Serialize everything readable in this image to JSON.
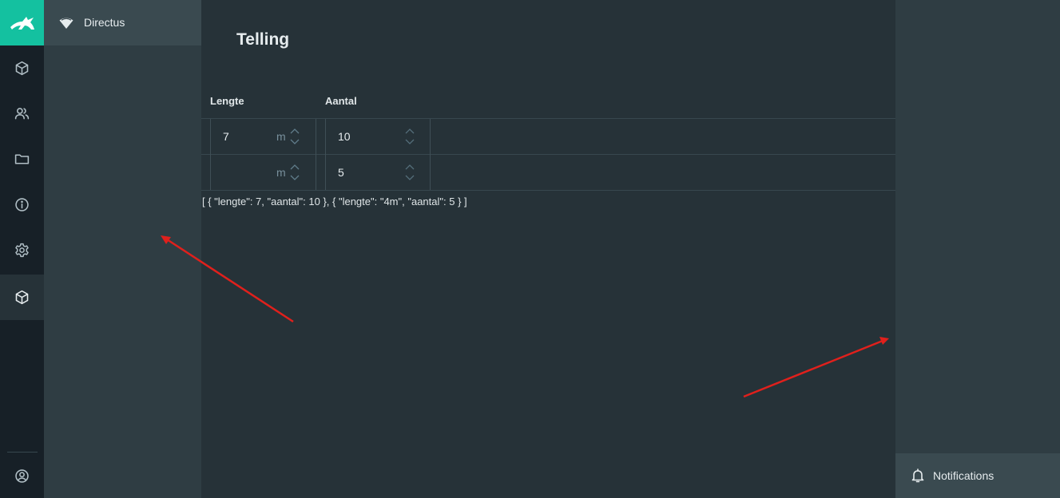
{
  "project": {
    "name": "Directus"
  },
  "page": {
    "title": "Telling"
  },
  "table": {
    "headers": [
      "Lengte",
      "Aantal"
    ],
    "rows": [
      {
        "lengte": "7",
        "unit": "m",
        "aantal": "10"
      },
      {
        "lengte": "",
        "unit": "m",
        "aantal": "5"
      }
    ]
  },
  "output": "[ { \"lengte\": 7, \"aantal\": 10 }, { \"lengte\": \"4m\", \"aantal\": 5 } ]",
  "sidebar": {
    "notifications_label": "Notifications"
  },
  "colors": {
    "accent": "#14c1a0",
    "arrow": "#e0201c"
  }
}
